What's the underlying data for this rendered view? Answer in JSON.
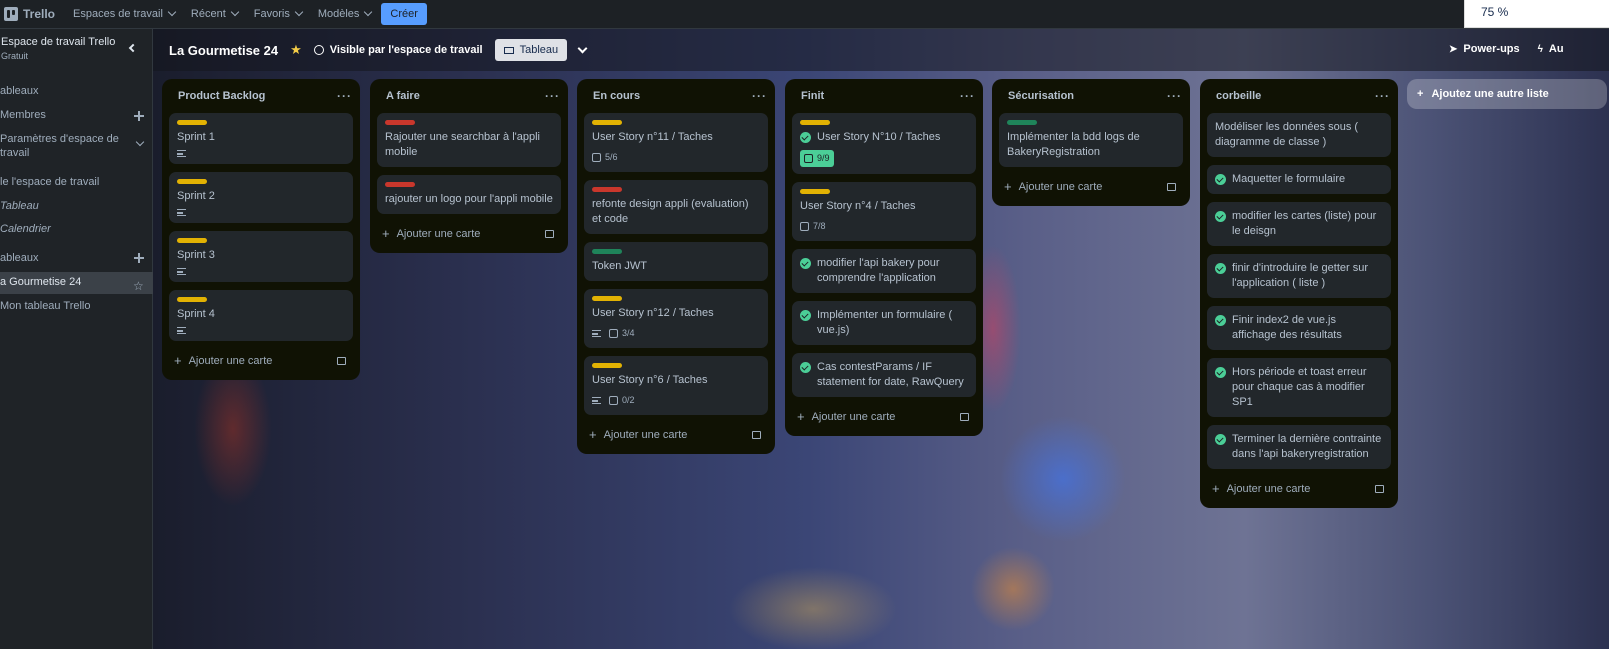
{
  "topbar": {
    "app_name": "Trello",
    "nav": [
      "Espaces de travail",
      "Récent",
      "Favoris",
      "Modèles"
    ],
    "create_label": "Créer",
    "zoom": "75 %"
  },
  "sidebar": {
    "workspace_title": "Espace de travail Trello",
    "workspace_plan": "Gratuit",
    "items": [
      "ableaux",
      "Membres",
      "Paramètres d'espace de",
      "travail",
      "le l'espace de travail",
      "Tableau",
      "Calendrier",
      "ableaux",
      "a Gourmetise 24",
      "Mon tableau Trello"
    ]
  },
  "board": {
    "title": "La Gourmetise 24",
    "visibility": "Visible par l'espace de travail",
    "view_label": "Tableau",
    "powerups": "Power-ups",
    "automation": "Au",
    "add_list": "Ajoutez une autre liste",
    "colors": {
      "yellow": "#e2b203",
      "red": "#c9372c",
      "green": "#1f845a",
      "done": "#4bce97"
    }
  },
  "lists": [
    {
      "title": "Product Backlog",
      "add_card": "Ajouter une carte",
      "cards": [
        {
          "title": "Sprint 1"
        },
        {
          "title": "Sprint 2"
        },
        {
          "title": "Sprint 3"
        },
        {
          "title": "Sprint 4"
        }
      ]
    },
    {
      "title": "A faire",
      "add_card": "Ajouter une carte",
      "cards": [
        {
          "title": "Rajouter une searchbar à l'appli mobile"
        },
        {
          "title": "rajouter un logo pour l'appli mobile"
        }
      ]
    },
    {
      "title": "En cours",
      "add_card": "Ajouter une carte",
      "cards": [
        {
          "title": "User Story n°11 / Taches",
          "checklist": "5/6"
        },
        {
          "title": "refonte design appli (evaluation) et code"
        },
        {
          "title": "Token JWT"
        },
        {
          "title": "User Story n°12 / Taches",
          "checklist": "3/4"
        },
        {
          "title": "User Story n°6 / Taches",
          "checklist": "0/2"
        }
      ]
    },
    {
      "title": "Finit",
      "add_card": "Ajouter une carte",
      "cards": [
        {
          "title": "User Story N°10 / Taches",
          "checklist": "9/9"
        },
        {
          "title": "User Story n°4 / Taches",
          "checklist": "7/8"
        },
        {
          "title": "modifier l'api bakery pour comprendre l'application"
        },
        {
          "title": "Implémenter un formulaire ( vue.js)"
        },
        {
          "title": "Cas contestParams / IF statement for date, RawQuery"
        }
      ]
    },
    {
      "title": "Sécurisation",
      "add_card": "Ajouter une carte",
      "cards": [
        {
          "title": "Implémenter la bdd logs de BakeryRegistration"
        }
      ]
    },
    {
      "title": "corbeille",
      "add_card": "Ajouter une carte",
      "cards": [
        {
          "title": "Modéliser les données sous ( diagramme de classe )"
        },
        {
          "title": "Maquetter le formulaire"
        },
        {
          "title": "modifier les cartes (liste) pour le deisgn"
        },
        {
          "title": "finir d'introduire le getter sur l'application ( liste )"
        },
        {
          "title": "Finir index2 de vue.js affichage des résultats"
        },
        {
          "title": "Hors période et toast erreur pour chaque cas à modifier SP1"
        },
        {
          "title": "Terminer la dernière contrainte dans l'api bakeryregistration"
        }
      ]
    }
  ]
}
